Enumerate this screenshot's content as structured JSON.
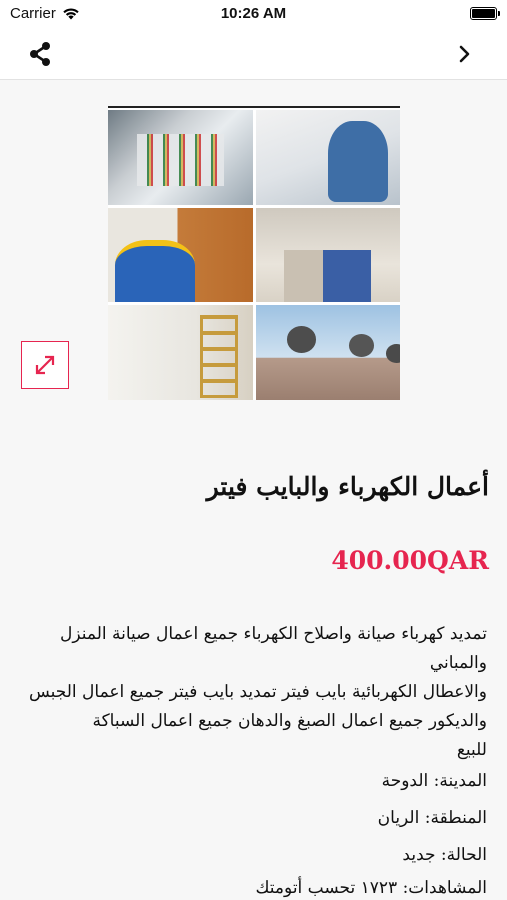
{
  "status_bar": {
    "carrier": "Carrier",
    "time": "10:26 AM"
  },
  "nav": {
    "share_icon": "share-icon",
    "next_icon": "chevron-right-icon"
  },
  "listing": {
    "title": "أعمال الكهرباء والبايب فيتر",
    "price": "400.00QAR",
    "description": [
      "تمديد كهرباء صيانة واصلاح الكهرباء جميع اعمال صيانة المنزل والمباني",
      "والاعطال الكهربائية بايب فيتر تمديد بايب فيتر جميع اعمال الجبس",
      "والديكور جميع اعمال الصبغ والدهان جميع اعمال السباكة",
      "للبيع"
    ],
    "details": [
      "المدينة: الدوحة",
      "المنطقة: الريان",
      "الحالة: جديد",
      "المشاهدات: ١٧٢٣ تحسب أتومتك"
    ]
  },
  "colors": {
    "accent": "#e6254f",
    "background": "#f7f7f7"
  }
}
